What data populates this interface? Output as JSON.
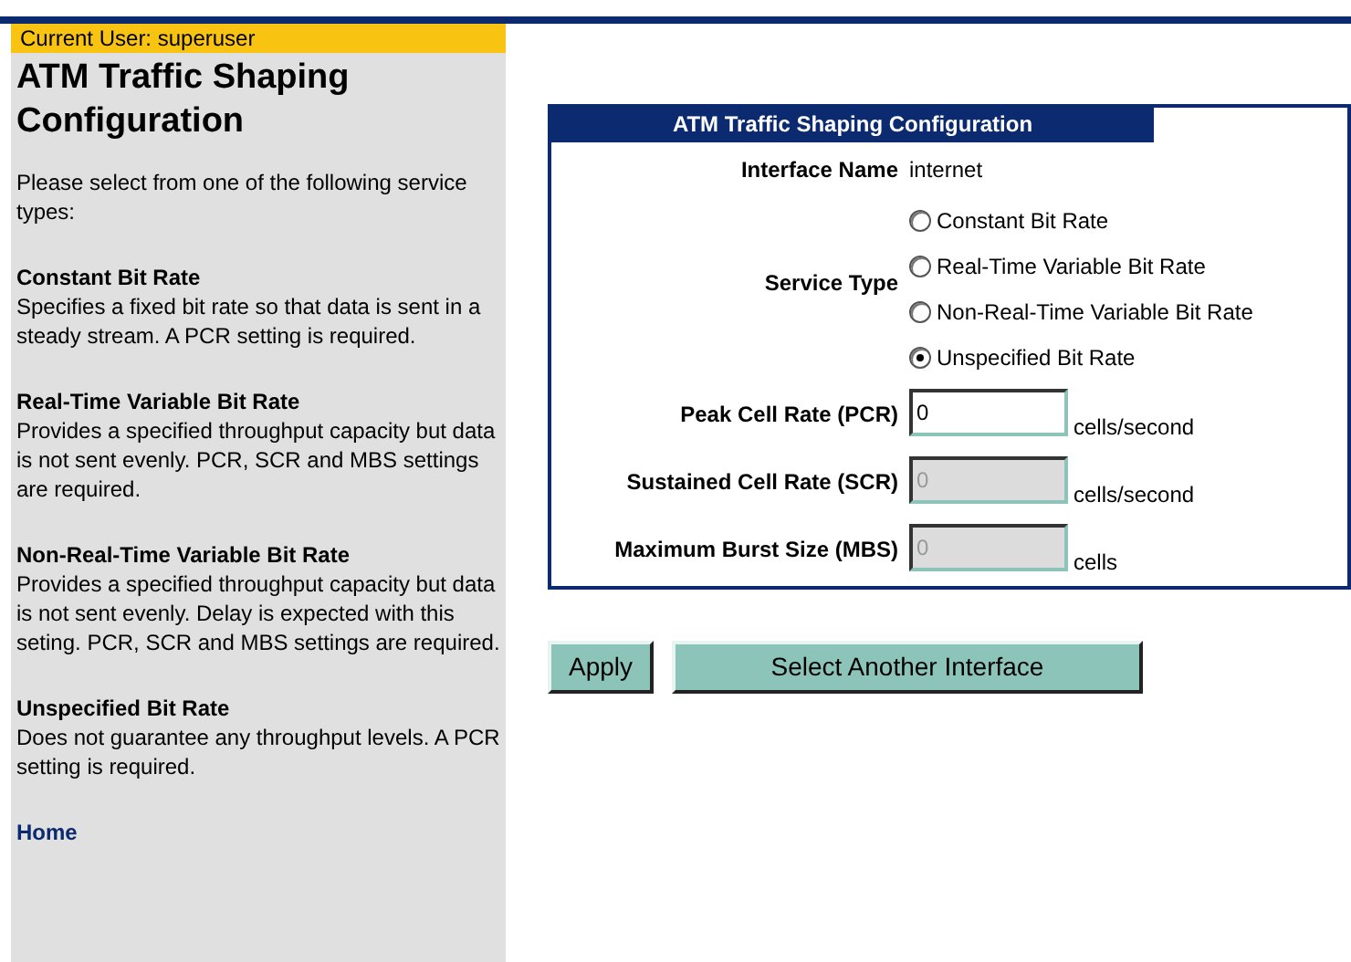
{
  "user_bar": {
    "text": "Current User: superuser"
  },
  "sidebar": {
    "title": "ATM Traffic Shaping Configuration",
    "intro": "Please select from one of the following service types:",
    "sections": [
      {
        "heading": "Constant Bit Rate",
        "body": "Specifies a fixed bit rate so that data is sent in a steady stream. A PCR setting is required."
      },
      {
        "heading": "Real-Time Variable Bit Rate",
        "body": "Provides a specified throughput capacity but data is not sent evenly. PCR, SCR and MBS settings are required."
      },
      {
        "heading": "Non-Real-Time Variable Bit Rate",
        "body": "Provides a specified throughput capacity but data is not sent evenly. Delay is expected with this seting. PCR, SCR and MBS settings are required."
      },
      {
        "heading": "Unspecified Bit Rate",
        "body": "Does not guarantee any throughput levels. A PCR setting is required."
      }
    ],
    "home_link": "Home"
  },
  "form": {
    "title": "ATM Traffic Shaping Configuration",
    "interface": {
      "label": "Interface Name",
      "value": "internet"
    },
    "service_type": {
      "label": "Service Type",
      "options": [
        {
          "label": "Constant Bit Rate",
          "selected": false
        },
        {
          "label": "Real-Time Variable Bit Rate",
          "selected": false
        },
        {
          "label": "Non-Real-Time Variable Bit Rate",
          "selected": false
        },
        {
          "label": "Unspecified Bit Rate",
          "selected": true
        }
      ]
    },
    "fields": [
      {
        "label": "Peak Cell Rate (PCR)",
        "value": "0",
        "unit": "cells/second",
        "disabled": false
      },
      {
        "label": "Sustained Cell Rate (SCR)",
        "value": "0",
        "unit": "cells/second",
        "disabled": true
      },
      {
        "label": "Maximum Burst Size (MBS)",
        "value": "0",
        "unit": "cells",
        "disabled": true
      }
    ]
  },
  "buttons": [
    "Apply",
    "Select Another Interface"
  ]
}
